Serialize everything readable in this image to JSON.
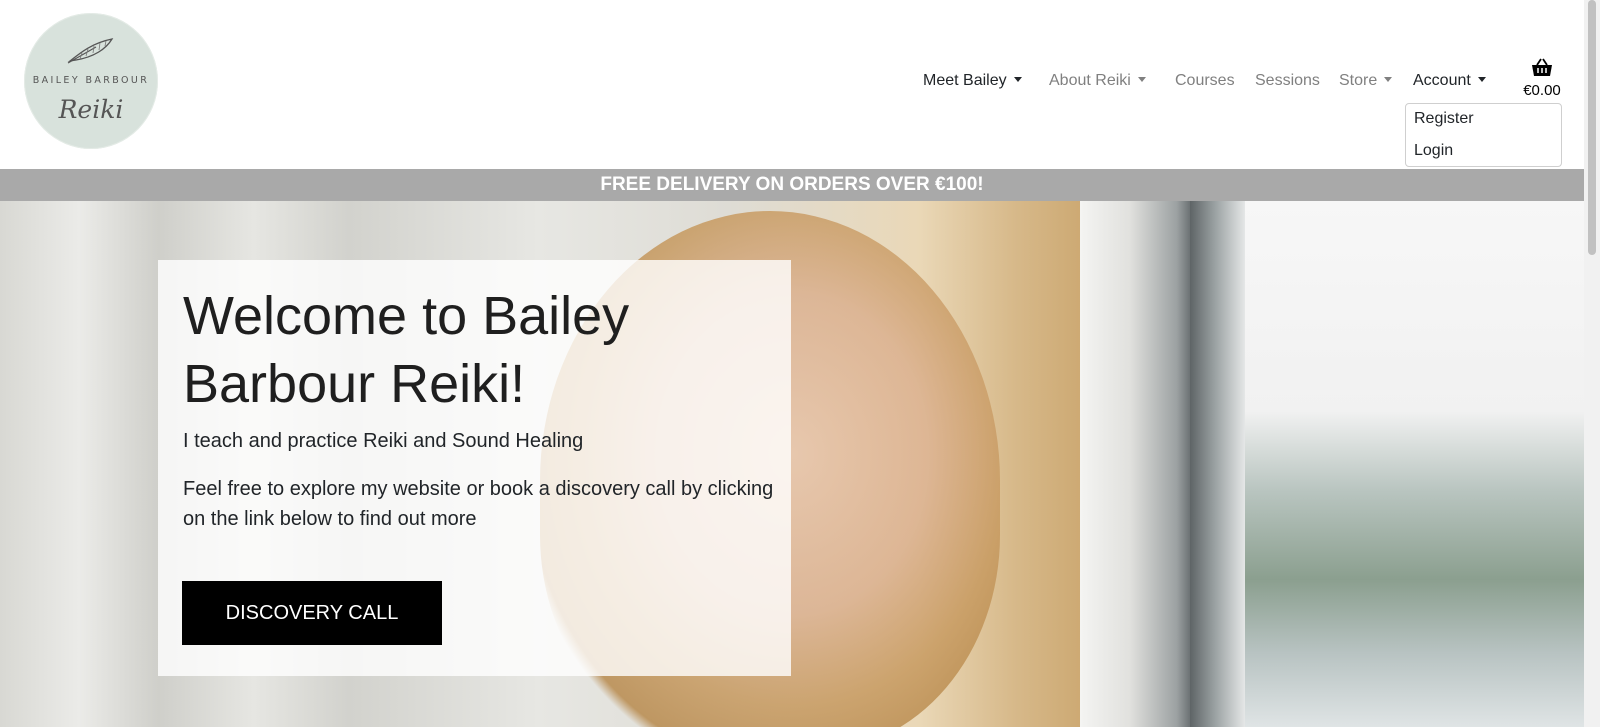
{
  "logo": {
    "top_text": "BAILEY BARBOUR",
    "script_text": "Reiki"
  },
  "nav": {
    "items": [
      {
        "label": "Meet Bailey",
        "dropdown": true,
        "active": true
      },
      {
        "label": "About Reiki",
        "dropdown": true,
        "active": false
      },
      {
        "label": "Courses",
        "dropdown": false,
        "active": false
      },
      {
        "label": "Sessions",
        "dropdown": false,
        "active": false
      },
      {
        "label": "Store",
        "dropdown": true,
        "active": false
      },
      {
        "label": "Account",
        "dropdown": true,
        "active": true
      }
    ]
  },
  "cart": {
    "total": "€0.00",
    "icon": "basket-icon"
  },
  "account_menu": {
    "items": [
      "Register",
      "Login"
    ]
  },
  "banner": {
    "text": "FREE DELIVERY ON ORDERS OVER €100!"
  },
  "hero": {
    "title": "Welcome to Bailey Barbour Reiki!",
    "subtitle": "I teach and practice Reiki and Sound Healing",
    "text": "Feel free to explore my website or book a discovery call by clicking on the link below to find out more",
    "cta_label": "DISCOVERY CALL"
  },
  "colors": {
    "banner_bg": "#a9a9a9",
    "cta_bg": "#000000",
    "logo_bg": "#d8e2dc"
  }
}
